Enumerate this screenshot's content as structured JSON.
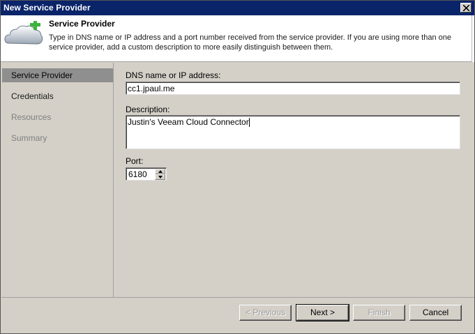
{
  "window": {
    "title": "New Service Provider"
  },
  "header": {
    "title": "Service Provider",
    "description": "Type in DNS name or IP address and a port number received from the service provider. If you are using more than one service provider, add a custom description to more easily distinguish between them."
  },
  "nav": {
    "items": [
      {
        "label": "Service Provider",
        "state": "active"
      },
      {
        "label": "Credentials",
        "state": "enabled"
      },
      {
        "label": "Resources",
        "state": "disabled"
      },
      {
        "label": "Summary",
        "state": "disabled"
      }
    ]
  },
  "form": {
    "dns_label": "DNS name or IP address:",
    "dns_value": "cc1.jpaul.me",
    "description_label": "Description:",
    "description_value": "Justin's Veeam Cloud Connector",
    "port_label": "Port:",
    "port_value": "6180"
  },
  "buttons": {
    "previous": "< Previous",
    "next": "Next >",
    "finish": "Finish",
    "cancel": "Cancel"
  },
  "colors": {
    "titlebar": "#0a246a",
    "nav_active": "#8f8f8f",
    "cloud_plus": "#3cb43c"
  },
  "icons": {
    "header": "cloud-add-icon",
    "close": "close-icon",
    "spin_up": "arrow-up-icon",
    "spin_down": "arrow-down-icon"
  }
}
